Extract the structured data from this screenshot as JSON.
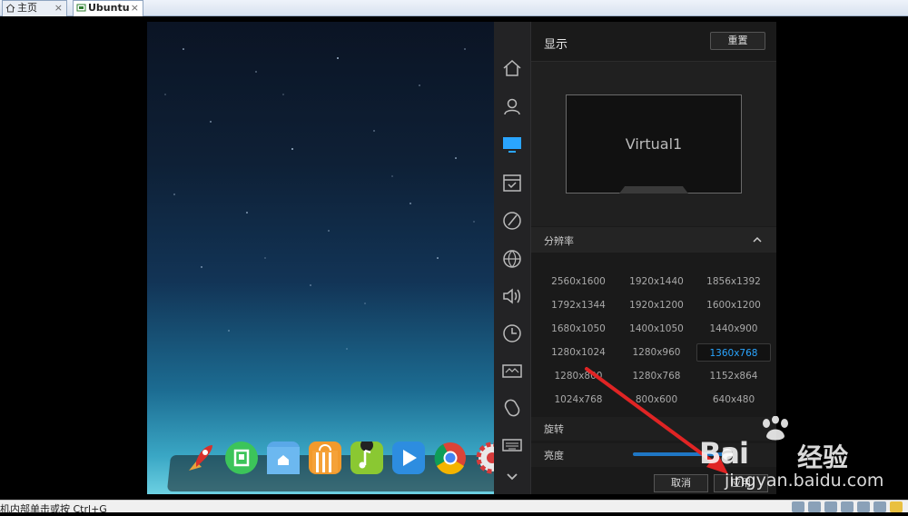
{
  "host": {
    "tabs": [
      {
        "label": "主页",
        "icon": "home-icon",
        "active": false
      },
      {
        "label": "Ubuntu",
        "icon": "vm-icon",
        "active": true
      }
    ],
    "close_glyph": "×",
    "status_hint": "机内部单击或按 Ctrl+G"
  },
  "settings": {
    "title": "显示",
    "reset_label": "重置",
    "monitor_name": "Virtual1",
    "resolution_section": "分辨率",
    "resolutions": [
      "2560x1600",
      "1920x1440",
      "1856x1392",
      "1792x1344",
      "1920x1200",
      "1600x1200",
      "1680x1050",
      "1400x1050",
      "1440x900",
      "1280x1024",
      "1280x960",
      "1360x768",
      "1280x800",
      "1280x768",
      "1152x864",
      "1024x768",
      "800x600",
      "640x480"
    ],
    "selected_resolution": "1360x768",
    "rotation_label": "旋转",
    "brightness_label": "亮度",
    "brightness_level": 0.92,
    "cancel_label": "取消",
    "apply_label": "应用",
    "sidebar_icons": [
      "home-icon",
      "user-icon",
      "display-icon",
      "calendar-icon",
      "personalization-icon",
      "network-icon",
      "sound-icon",
      "time-icon",
      "power-icon",
      "mouse-icon",
      "keyboard-icon",
      "more-icon"
    ],
    "accent_color": "#2aa5ff"
  },
  "dock": {
    "apps": [
      "launcher-icon",
      "store-icon",
      "file-manager-icon",
      "app-store-icon",
      "music-icon",
      "video-icon",
      "chrome-icon",
      "settings-icon"
    ]
  },
  "watermark": {
    "brand": "Bai",
    "brand_cn": "经验",
    "url": "jingyan.baidu.com"
  }
}
